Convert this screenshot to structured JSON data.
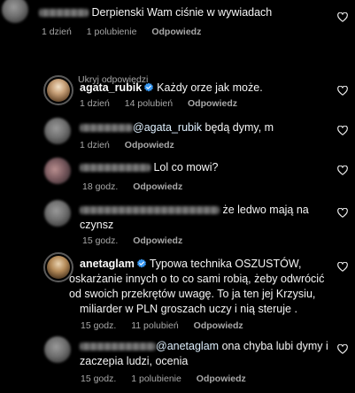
{
  "colors": {
    "background": "#000000",
    "text": "#f5f5f5",
    "meta": "#a8a8a8",
    "verified": "#3897f0"
  },
  "top_comment": {
    "text": "Derpienski Wam ciśnie w wywiadach",
    "time": "1 dzień",
    "likes": "1 polubienie",
    "reply": "Odpowiedz"
  },
  "hide_replies_label": "Ukryj odpowiedzi",
  "replies": [
    {
      "username": "agata_rubik",
      "text": "Każdy orze jak może.",
      "time": "1 dzień",
      "likes": "14 polubień",
      "reply": "Odpowiedz"
    },
    {
      "mention": "@agata_rubik",
      "text": "będą dymy, m",
      "time": "1 dzień",
      "reply": "Odpowiedz"
    },
    {
      "text": "Lol co mowi?",
      "time": "18 godz.",
      "reply": "Odpowiedz"
    },
    {
      "text_line1": "że ledwo mają na",
      "text_line2": "czynsz",
      "time": "15 godz.",
      "reply": "Odpowiedz"
    },
    {
      "username": "anetaglam",
      "text_line1": "Typowa technika OSZUSTÓW,",
      "text_line2": "oskarżanie innych o to co sami robią, żeby odwrócić",
      "text_line3": "od swoich przekrętów uwagę. To ja ten jej Krzysiu,",
      "text_line4": "miliarder w PLN groszach uczy i nią steruje .",
      "time": "15 godz.",
      "likes": "11 polubień",
      "reply": "Odpowiedz"
    },
    {
      "mention": "@anetaglam",
      "text_line1": "ona chyba lubi dymy i",
      "text_line2": "zaczepia ludzi, ocenia",
      "time": "15 godz.",
      "likes": "1 polubienie",
      "reply": "Odpowiedz"
    }
  ],
  "icons": {
    "like": "heart-outline-icon",
    "verified": "verified-badge-icon"
  }
}
